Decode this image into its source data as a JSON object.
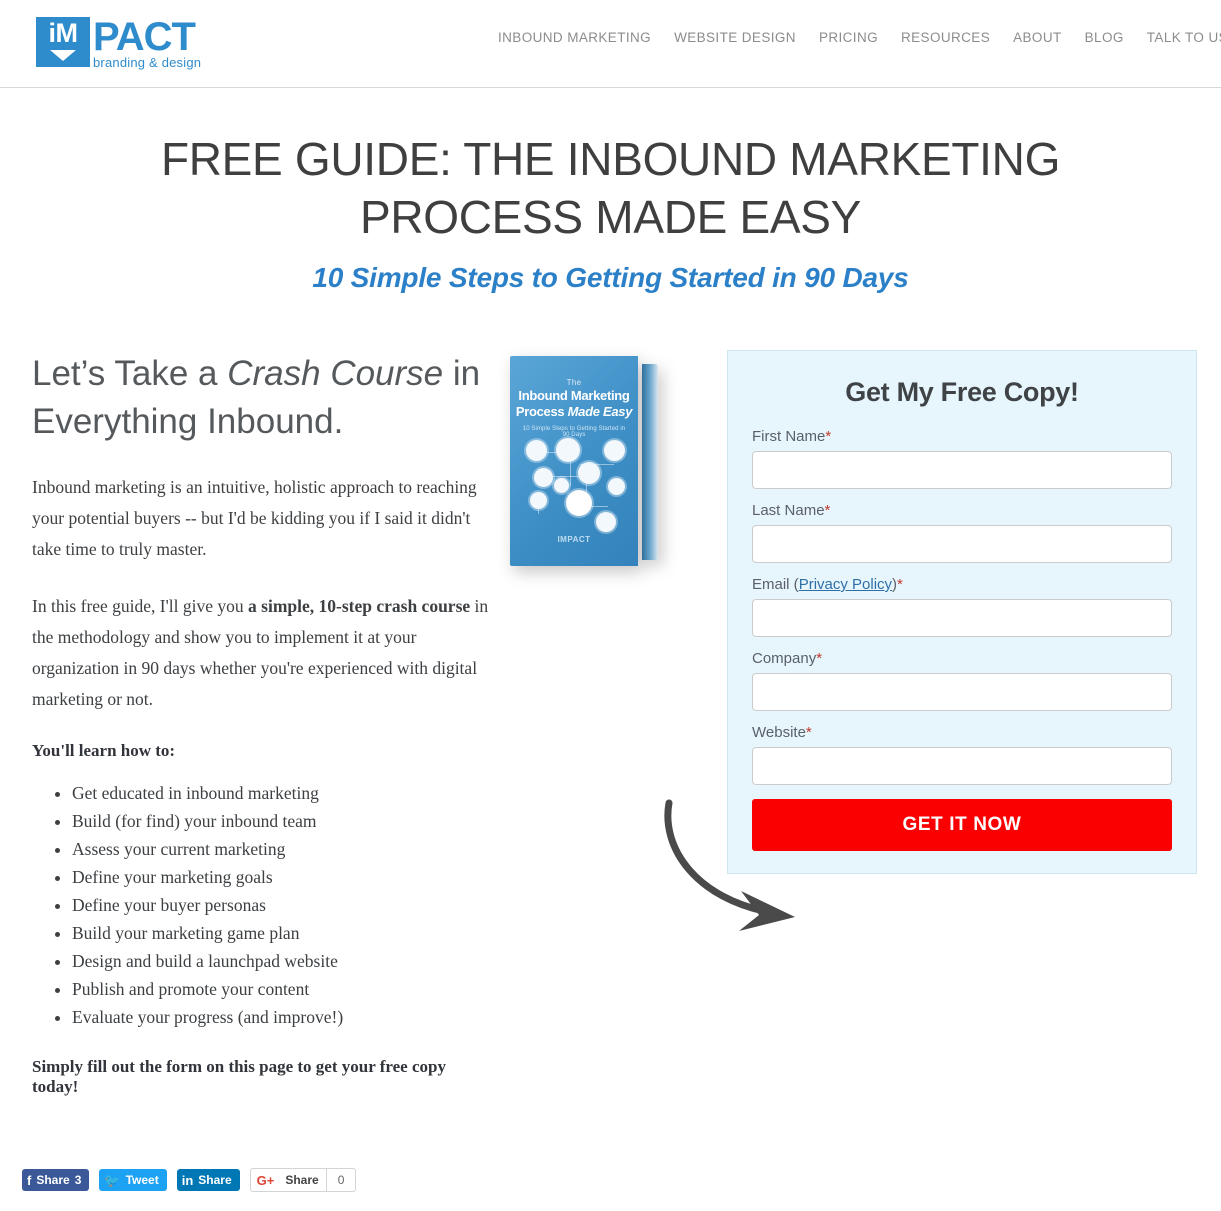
{
  "header": {
    "logo": {
      "mark_text": "iM",
      "word": "PACT",
      "tagline": "branding & design"
    },
    "nav": [
      {
        "label": "INBOUND MARKETING"
      },
      {
        "label": "WEBSITE DESIGN"
      },
      {
        "label": "PRICING"
      },
      {
        "label": "RESOURCES"
      },
      {
        "label": "ABOUT"
      },
      {
        "label": "BLOG"
      },
      {
        "label": "TALK TO US"
      }
    ]
  },
  "hero": {
    "title": "FREE GUIDE: THE INBOUND MARKETING PROCESS MADE EASY",
    "subtitle": "10 Simple Steps to Getting Started in 90 Days"
  },
  "left": {
    "heading_pre": "Let’s Take a ",
    "heading_em": "Crash Course",
    "heading_post": " in Everything Inbound.",
    "paragraph1": "Inbound marketing is an intuitive, holistic approach to reaching your potential buyers -- but I'd be kidding you if I said it didn't take time to truly master.",
    "paragraph2_pre": "In this free guide, I'll give you ",
    "paragraph2_bold": "a simple, 10-step crash course",
    "paragraph2_post": " in the methodology and show you to implement it at your organization in 90 days whether you're experienced with digital marketing or not.",
    "learn_lead": "You'll learn how to:",
    "bullets": [
      "Get educated in inbound marketing",
      "Build (for find) your inbound team",
      "Assess your current marketing",
      "Define your marketing goals",
      "Define your buyer personas",
      "Build your marketing game plan",
      "Design and build a launchpad website",
      "Publish and promote your content",
      "Evaluate your progress (and improve!)"
    ],
    "closing": "Simply fill out the form on this page to get your free copy today!"
  },
  "ebook": {
    "eyebrow": "The",
    "title_line1": "Inbound Marketing",
    "title_line2_pre": "Process ",
    "title_line2_em": "Made Easy",
    "subtitle": "10 Simple Steps to Getting Started in 90 Days",
    "brand": "IMPACT"
  },
  "form": {
    "title": "Get My Free Copy!",
    "fields": [
      {
        "label": "First Name",
        "required": true,
        "value": "",
        "placeholder": ""
      },
      {
        "label": "Last Name",
        "required": true,
        "value": "",
        "placeholder": ""
      },
      {
        "label": "Email",
        "link_text": "Privacy Policy",
        "required": true,
        "value": "",
        "placeholder": ""
      },
      {
        "label": "Company",
        "required": true,
        "value": "",
        "placeholder": ""
      },
      {
        "label": "Website",
        "required": true,
        "value": "",
        "placeholder": ""
      }
    ],
    "submit_label": "GET IT NOW",
    "submit_color": "#fa0000",
    "panel_color": "#e7f6fd"
  },
  "social": {
    "facebook": {
      "label": "Share",
      "count": "3",
      "glyph": "f"
    },
    "twitter": {
      "label": "Tweet",
      "glyph": "🐦"
    },
    "linkedin": {
      "label": "Share",
      "glyph": "in"
    },
    "googleplus": {
      "label": "Share",
      "count": "0",
      "glyph": "G+"
    }
  },
  "colors": {
    "brand_blue": "#2f8ccc",
    "subtitle_blue": "#2b80c8",
    "cta_red": "#fa0000",
    "panel_bg": "#e7f6fd",
    "nav_grey": "#8c8c8c"
  }
}
